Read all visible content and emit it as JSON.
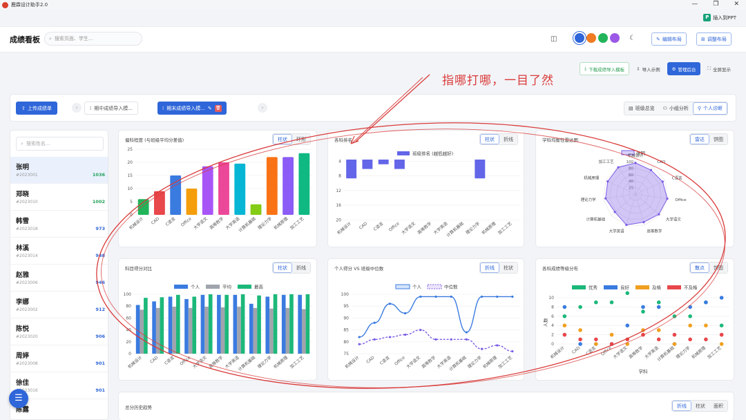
{
  "app": {
    "title": "鹿霖设计助手2.0",
    "insert_ppt": "插入到PPT"
  },
  "header": {
    "brand": "成绩看板",
    "search_placeholder": "搜索页面、学生...",
    "edit_layout": "编辑布局",
    "adjust_layout": "调整布局",
    "theme_colors": [
      "#2f66d9",
      "#f07b22",
      "#22b45a",
      "#9b59e6"
    ]
  },
  "toolbar": {
    "download_template": "下载成绩导入模板",
    "import_example": "导入示例",
    "admin": "管理后台",
    "fullscreen": "全屏显示"
  },
  "annotation": "指哪打哪，一目了然",
  "topbar": {
    "upload": "上传成绩单",
    "tabs": [
      {
        "label": "期中成绩导入模..."
      },
      {
        "label": "期末成绩导入模..."
      }
    ],
    "views": [
      "班级总览",
      "小组分析",
      "个人诊断"
    ]
  },
  "sidebar": {
    "search_placeholder": "搜索姓名...",
    "students": [
      {
        "name": "张明",
        "id": "#2023001",
        "score": "1036",
        "color": "#23a15a"
      },
      {
        "name": "郑晓",
        "id": "#2023010",
        "score": "1002",
        "color": "#23a15a"
      },
      {
        "name": "韩雪",
        "id": "#2023018",
        "score": "973",
        "color": "#2f66d9"
      },
      {
        "name": "林溪",
        "id": "#2023014",
        "score": "948",
        "color": "#2f66d9"
      },
      {
        "name": "赵雅",
        "id": "#2023006",
        "score": "946",
        "color": "#2f66d9"
      },
      {
        "name": "李娜",
        "id": "#2023002",
        "score": "912",
        "color": "#2f66d9"
      },
      {
        "name": "陈悦",
        "id": "#2023020",
        "score": "906",
        "color": "#2f66d9"
      },
      {
        "name": "周婷",
        "id": "#2023008",
        "score": "901",
        "color": "#2f66d9"
      },
      {
        "name": "徐佳",
        "id": "#2023016",
        "score": "901",
        "color": "#2f66d9"
      },
      {
        "name": "陈露",
        "id": "",
        "score": "",
        "color": "#2f66d9"
      }
    ]
  },
  "cards": {
    "c1": {
      "title": "偏科程度 (与班级平均分差值)",
      "tabs": [
        "柱状",
        "环形"
      ]
    },
    "c2": {
      "title": "各科排名",
      "tabs": [
        "柱状",
        "折线"
      ]
    },
    "c3": {
      "title": "学科均衡性雷达图",
      "tabs": [
        "雷达",
        "饼图"
      ]
    },
    "c4": {
      "title": "科目得分对比",
      "tabs": [
        "柱状",
        "折线"
      ]
    },
    "c5": {
      "title": "个人得分 VS 班级中位数",
      "tabs": [
        "折线",
        "柱状"
      ]
    },
    "c6": {
      "title": "各科成绩等级分布",
      "tabs": [
        "散点",
        "饼图"
      ]
    },
    "c7": {
      "title": "总分历史趋势",
      "tabs": [
        "折线",
        "柱状",
        "面积"
      ]
    }
  },
  "chart_data": [
    {
      "type": "bar",
      "name": "c1",
      "categories": [
        "机械设计",
        "CAD",
        "C语言",
        "Office",
        "大学语文",
        "高等数学",
        "大学英语",
        "计算机基础",
        "理论力学",
        "机械原理",
        "加工工艺"
      ],
      "values": [
        6,
        9,
        15,
        10,
        18.5,
        20,
        19.5,
        4,
        22,
        22,
        23.5
      ],
      "colors": [
        "#22b45a",
        "#e8474b",
        "#3a7be0",
        "#f59e0b",
        "#a855f7",
        "#ec4899",
        "#06b6d4",
        "#84cc16",
        "#f97316",
        "#8b5cf6",
        "#10b981"
      ],
      "ylim": [
        0,
        25
      ],
      "yticks": [
        0,
        5,
        10,
        15,
        20,
        25
      ]
    },
    {
      "type": "bar",
      "name": "c2",
      "categories": [
        "机械设计",
        "CAD",
        "C语言",
        "Office",
        "大学语文",
        "高等数学",
        "大学英语",
        "计算机基础",
        "理论力学",
        "机械原理",
        "加工工艺"
      ],
      "values": [
        8,
        4,
        2,
        4,
        0,
        0,
        0,
        0,
        8,
        0,
        0
      ],
      "legend": "班级排名 (越低越好)",
      "ylim": [
        0,
        20
      ],
      "yticks": [
        4,
        8,
        12,
        16,
        20
      ]
    },
    {
      "type": "radar",
      "name": "c3",
      "categories": [
        "机械设计",
        "CAD",
        "C语言",
        "Office",
        "大学语文",
        "高等数学",
        "大学英语",
        "计算机基础",
        "理论力学",
        "机械原理",
        "加工工艺"
      ],
      "values": [
        96,
        88,
        92,
        99,
        95,
        90,
        99,
        84,
        93,
        94,
        98
      ],
      "legend": "张明",
      "range": [
        0,
        100
      ],
      "ticks": [
        20,
        40,
        60,
        80,
        100
      ]
    },
    {
      "type": "bar",
      "name": "c4",
      "categories": [
        "机械设计",
        "CAD",
        "C语言",
        "Office",
        "大学语文",
        "高等数学",
        "大学英语",
        "计算机基础",
        "理论力学",
        "机械原理",
        "加工工艺"
      ],
      "series": [
        {
          "name": "个人",
          "values": [
            82,
            88,
            96,
            92,
            99,
            99,
            99,
            84,
            96,
            99,
            99
          ],
          "color": "#3a7be0"
        },
        {
          "name": "平均",
          "values": [
            74,
            77,
            79,
            77,
            79,
            78,
            79,
            77,
            76,
            77,
            75
          ],
          "color": "#a0a4ad"
        },
        {
          "name": "最高",
          "values": [
            94,
            95,
            99,
            96,
            100,
            99,
            100,
            98,
            100,
            100,
            100
          ],
          "color": "#1cb87a"
        }
      ],
      "ylim": [
        0,
        100
      ],
      "yticks": [
        0,
        20,
        40,
        60,
        80,
        100
      ]
    },
    {
      "type": "line",
      "name": "c5",
      "categories": [
        "机械设计",
        "CAD",
        "C语言",
        "Office",
        "大学语文",
        "高等数学",
        "大学英语",
        "计算机基础",
        "理论力学",
        "机械原理",
        "加工工艺"
      ],
      "series": [
        {
          "name": "个人",
          "values": [
            82,
            88,
            96,
            92,
            99,
            99,
            99,
            84,
            99,
            99,
            99
          ]
        },
        {
          "name": "中位数",
          "values": [
            79,
            81,
            82,
            83,
            85,
            81,
            81,
            81,
            77,
            78.5,
            76
          ]
        }
      ],
      "ylim": [
        75,
        100
      ],
      "yticks": [
        75,
        80,
        85,
        90,
        95,
        100
      ]
    },
    {
      "type": "scatter",
      "name": "c6",
      "categories": [
        "机械设计",
        "CAD",
        "C语言",
        "Office",
        "大学语文",
        "高等数学",
        "大学英语",
        "计算机基础",
        "理论力学",
        "机械原理",
        "加工工艺"
      ],
      "ylabel": "人数",
      "xlabel": "学科",
      "series": [
        {
          "name": "优秀",
          "color": "#1cb87a",
          "values": [
            6,
            8,
            9,
            9,
            11,
            7,
            9,
            6,
            6,
            9,
            4
          ]
        },
        {
          "name": "良好",
          "color": "#3a7be0",
          "values": [
            8,
            0,
            0,
            0,
            4,
            8,
            8,
            0,
            8,
            9,
            10
          ]
        },
        {
          "name": "及格",
          "color": "#f0a020",
          "values": [
            4,
            3,
            0,
            2,
            0,
            3,
            3,
            0,
            4,
            4,
            0
          ]
        },
        {
          "name": "不及格",
          "color": "#e8474b",
          "values": [
            2,
            1,
            1,
            0,
            1,
            2,
            1,
            2,
            1,
            1,
            2
          ]
        }
      ],
      "ylim": [
        0,
        10
      ],
      "yticks": [
        0,
        2,
        4,
        6,
        8,
        10
      ]
    }
  ]
}
